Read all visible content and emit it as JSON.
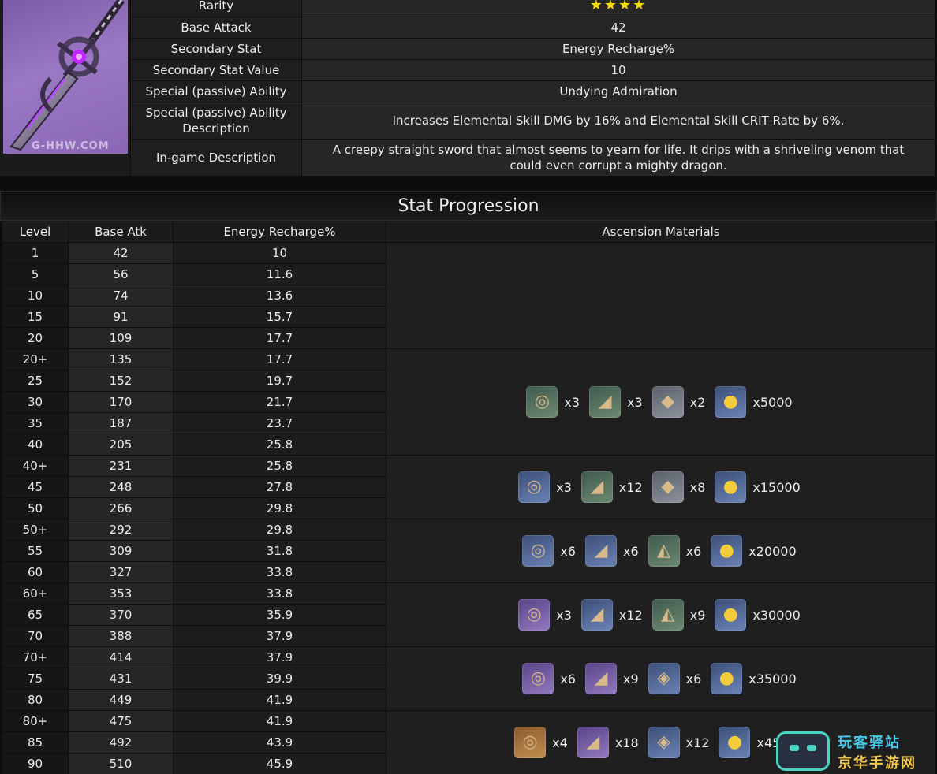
{
  "weapon": {
    "portrait_watermark": "G-HHW.COM",
    "rows": [
      {
        "label": "Rarity",
        "value": "★★★★"
      },
      {
        "label": "Base Attack",
        "value": "42"
      },
      {
        "label": "Secondary Stat",
        "value": "Energy Recharge%"
      },
      {
        "label": "Secondary Stat Value",
        "value": "10"
      },
      {
        "label": "Special (passive) Ability",
        "value": "Undying Admiration"
      },
      {
        "label": "Special (passive) Ability Description",
        "value": "Increases Elemental Skill DMG by 16% and Elemental Skill CRIT Rate by 6%."
      },
      {
        "label": "In-game Description",
        "value": "A creepy straight sword that almost seems to yearn for life. It drips with a shriveling venom that could even corrupt a mighty dragon."
      }
    ],
    "colors": {
      "star": "#f5d90a",
      "sword_glow": "#c026ff"
    }
  },
  "progression": {
    "title": "Stat Progression",
    "headers": [
      "Level",
      "Base Atk",
      "Energy Recharge%",
      "Ascension Materials"
    ],
    "rows": [
      [
        "1",
        "42",
        "10"
      ],
      [
        "5",
        "56",
        "11.6"
      ],
      [
        "10",
        "74",
        "13.6"
      ],
      [
        "15",
        "91",
        "15.7"
      ],
      [
        "20",
        "109",
        "17.7"
      ],
      [
        "20+",
        "135",
        "17.7"
      ],
      [
        "25",
        "152",
        "19.7"
      ],
      [
        "30",
        "170",
        "21.7"
      ],
      [
        "35",
        "187",
        "23.7"
      ],
      [
        "40",
        "205",
        "25.8"
      ],
      [
        "40+",
        "231",
        "25.8"
      ],
      [
        "45",
        "248",
        "27.8"
      ],
      [
        "50",
        "266",
        "29.8"
      ],
      [
        "50+",
        "292",
        "29.8"
      ],
      [
        "55",
        "309",
        "31.8"
      ],
      [
        "60",
        "327",
        "33.8"
      ],
      [
        "60+",
        "353",
        "33.8"
      ],
      [
        "65",
        "370",
        "35.9"
      ],
      [
        "70",
        "388",
        "37.9"
      ],
      [
        "70+",
        "414",
        "37.9"
      ],
      [
        "75",
        "431",
        "39.9"
      ],
      [
        "80",
        "449",
        "41.9"
      ],
      [
        "80+",
        "475",
        "41.9"
      ],
      [
        "85",
        "492",
        "43.9"
      ],
      [
        "90",
        "510",
        "45.9"
      ]
    ],
    "material_groups": [
      {
        "rowspan": 5,
        "items": []
      },
      {
        "rowspan": 5,
        "items": [
          {
            "icon": "bronze-horn-icon",
            "glyph": "◎",
            "rarity": "r2",
            "qty": "x3"
          },
          {
            "icon": "horn-tusk-icon",
            "glyph": "◢",
            "rarity": "r2",
            "qty": "x3"
          },
          {
            "icon": "mask-fragment-icon",
            "glyph": "◆",
            "rarity": "rg",
            "qty": "x2"
          },
          {
            "icon": "mora-coin-icon",
            "glyph": "●",
            "rarity": "r3",
            "qty": "x5000"
          }
        ]
      },
      {
        "rowspan": 3,
        "items": [
          {
            "icon": "bronze-horn-icon",
            "glyph": "◎",
            "rarity": "r3",
            "qty": "x3"
          },
          {
            "icon": "horn-tusk-icon",
            "glyph": "◢",
            "rarity": "r2",
            "qty": "x12"
          },
          {
            "icon": "mask-fragment-icon",
            "glyph": "◆",
            "rarity": "rg",
            "qty": "x8"
          },
          {
            "icon": "mora-coin-icon",
            "glyph": "●",
            "rarity": "r3",
            "qty": "x15000"
          }
        ]
      },
      {
        "rowspan": 3,
        "items": [
          {
            "icon": "bronze-horn-icon",
            "glyph": "◎",
            "rarity": "r3",
            "qty": "x6"
          },
          {
            "icon": "horn-tusk-icon",
            "glyph": "◢",
            "rarity": "r3",
            "qty": "x6"
          },
          {
            "icon": "spiked-mask-icon",
            "glyph": "◭",
            "rarity": "r2",
            "qty": "x6"
          },
          {
            "icon": "mora-coin-icon",
            "glyph": "●",
            "rarity": "r3",
            "qty": "x20000"
          }
        ]
      },
      {
        "rowspan": 3,
        "items": [
          {
            "icon": "bronze-horn-icon",
            "glyph": "◎",
            "rarity": "r4",
            "qty": "x3"
          },
          {
            "icon": "horn-tusk-icon",
            "glyph": "◢",
            "rarity": "r3",
            "qty": "x12"
          },
          {
            "icon": "spiked-mask-icon",
            "glyph": "◭",
            "rarity": "r2",
            "qty": "x9"
          },
          {
            "icon": "mora-coin-icon",
            "glyph": "●",
            "rarity": "r3",
            "qty": "x30000"
          }
        ]
      },
      {
        "rowspan": 3,
        "items": [
          {
            "icon": "bronze-horn-icon",
            "glyph": "◎",
            "rarity": "r4",
            "qty": "x6"
          },
          {
            "icon": "horn-tusk-icon",
            "glyph": "◢",
            "rarity": "r4",
            "qty": "x9"
          },
          {
            "icon": "ornate-mask-icon",
            "glyph": "◈",
            "rarity": "r3",
            "qty": "x6"
          },
          {
            "icon": "mora-coin-icon",
            "glyph": "●",
            "rarity": "r3",
            "qty": "x35000"
          }
        ]
      },
      {
        "rowspan": 3,
        "items": [
          {
            "icon": "bronze-horn-icon",
            "glyph": "◎",
            "rarity": "r5",
            "qty": "x4"
          },
          {
            "icon": "horn-tusk-icon",
            "glyph": "◢",
            "rarity": "r4",
            "qty": "x18"
          },
          {
            "icon": "ornate-mask-icon",
            "glyph": "◈",
            "rarity": "r3",
            "qty": "x12"
          },
          {
            "icon": "mora-coin-icon",
            "glyph": "●",
            "rarity": "r3",
            "qty": "x45000"
          }
        ]
      }
    ]
  },
  "site_watermark": {
    "line1": "玩客驿站",
    "line2": "京华手游网"
  }
}
